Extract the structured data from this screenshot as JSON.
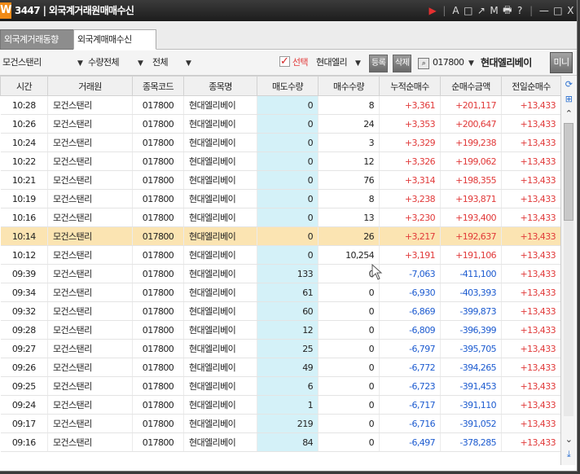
{
  "window": {
    "logo": "W",
    "title": "3447 | 외국계거래원매매수신",
    "controls": [
      "A",
      "□",
      "↗",
      "M",
      "🖶",
      "?",
      "|",
      "—",
      "□",
      "X"
    ]
  },
  "tabs": [
    {
      "label": "외국계거래동향"
    },
    {
      "label": "외국계매매수신"
    }
  ],
  "toolbar": {
    "broker": "모건스탠리",
    "qty_filter": "수량전체",
    "all_filter": "전체",
    "select_label": "선택",
    "stock_select": "현대엘리",
    "register": "등록",
    "delete": "삭제",
    "code": "017800",
    "stock_name": "현대엘리베이",
    "mini": "미니"
  },
  "table": {
    "headers": [
      "시간",
      "거래원",
      "종목코드",
      "종목명",
      "매도수량",
      "매수수량",
      "누적순매수",
      "순매수금액",
      "전일순매수"
    ],
    "rows": [
      {
        "time": "10:28",
        "broker": "모건스탠리",
        "code": "017800",
        "name": "현대엘리베이",
        "sell": "0",
        "buy": "8",
        "cum": "+3,361",
        "amt": "+201,117",
        "prev": "+13,433"
      },
      {
        "time": "10:26",
        "broker": "모건스탠리",
        "code": "017800",
        "name": "현대엘리베이",
        "sell": "0",
        "buy": "24",
        "cum": "+3,353",
        "amt": "+200,647",
        "prev": "+13,433"
      },
      {
        "time": "10:24",
        "broker": "모건스탠리",
        "code": "017800",
        "name": "현대엘리베이",
        "sell": "0",
        "buy": "3",
        "cum": "+3,329",
        "amt": "+199,238",
        "prev": "+13,433"
      },
      {
        "time": "10:22",
        "broker": "모건스탠리",
        "code": "017800",
        "name": "현대엘리베이",
        "sell": "0",
        "buy": "12",
        "cum": "+3,326",
        "amt": "+199,062",
        "prev": "+13,433"
      },
      {
        "time": "10:21",
        "broker": "모건스탠리",
        "code": "017800",
        "name": "현대엘리베이",
        "sell": "0",
        "buy": "76",
        "cum": "+3,314",
        "amt": "+198,355",
        "prev": "+13,433"
      },
      {
        "time": "10:19",
        "broker": "모건스탠리",
        "code": "017800",
        "name": "현대엘리베이",
        "sell": "0",
        "buy": "8",
        "cum": "+3,238",
        "amt": "+193,871",
        "prev": "+13,433"
      },
      {
        "time": "10:16",
        "broker": "모건스탠리",
        "code": "017800",
        "name": "현대엘리베이",
        "sell": "0",
        "buy": "13",
        "cum": "+3,230",
        "amt": "+193,400",
        "prev": "+13,433"
      },
      {
        "time": "10:14",
        "broker": "모건스탠리",
        "code": "017800",
        "name": "현대엘리베이",
        "sell": "0",
        "buy": "26",
        "cum": "+3,217",
        "amt": "+192,637",
        "prev": "+13,433",
        "selected": true
      },
      {
        "time": "10:12",
        "broker": "모건스탠리",
        "code": "017800",
        "name": "현대엘리베이",
        "sell": "0",
        "buy": "10,254",
        "cum": "+3,191",
        "amt": "+191,106",
        "prev": "+13,433"
      },
      {
        "time": "09:39",
        "broker": "모건스탠리",
        "code": "017800",
        "name": "현대엘리베이",
        "sell": "133",
        "buy": "0",
        "cum": "-7,063",
        "amt": "-411,100",
        "prev": "+13,433"
      },
      {
        "time": "09:34",
        "broker": "모건스탠리",
        "code": "017800",
        "name": "현대엘리베이",
        "sell": "61",
        "buy": "0",
        "cum": "-6,930",
        "amt": "-403,393",
        "prev": "+13,433"
      },
      {
        "time": "09:32",
        "broker": "모건스탠리",
        "code": "017800",
        "name": "현대엘리베이",
        "sell": "60",
        "buy": "0",
        "cum": "-6,869",
        "amt": "-399,873",
        "prev": "+13,433"
      },
      {
        "time": "09:28",
        "broker": "모건스탠리",
        "code": "017800",
        "name": "현대엘리베이",
        "sell": "12",
        "buy": "0",
        "cum": "-6,809",
        "amt": "-396,399",
        "prev": "+13,433"
      },
      {
        "time": "09:27",
        "broker": "모건스탠리",
        "code": "017800",
        "name": "현대엘리베이",
        "sell": "25",
        "buy": "0",
        "cum": "-6,797",
        "amt": "-395,705",
        "prev": "+13,433"
      },
      {
        "time": "09:26",
        "broker": "모건스탠리",
        "code": "017800",
        "name": "현대엘리베이",
        "sell": "49",
        "buy": "0",
        "cum": "-6,772",
        "amt": "-394,265",
        "prev": "+13,433"
      },
      {
        "time": "09:25",
        "broker": "모건스탠리",
        "code": "017800",
        "name": "현대엘리베이",
        "sell": "6",
        "buy": "0",
        "cum": "-6,723",
        "amt": "-391,453",
        "prev": "+13,433"
      },
      {
        "time": "09:24",
        "broker": "모건스탠리",
        "code": "017800",
        "name": "현대엘리베이",
        "sell": "1",
        "buy": "0",
        "cum": "-6,717",
        "amt": "-391,110",
        "prev": "+13,433"
      },
      {
        "time": "09:17",
        "broker": "모건스탠리",
        "code": "017800",
        "name": "현대엘리베이",
        "sell": "219",
        "buy": "0",
        "cum": "-6,716",
        "amt": "-391,052",
        "prev": "+13,433"
      },
      {
        "time": "09:16",
        "broker": "모건스탠리",
        "code": "017800",
        "name": "현대엘리베이",
        "sell": "84",
        "buy": "0",
        "cum": "-6,497",
        "amt": "-378,285",
        "prev": "+13,433"
      }
    ]
  },
  "colors": {
    "up": "#e13a3a",
    "down": "#1e5cd0",
    "sell_column": "#d4f1f8",
    "selected_row": "#fbe4b2"
  },
  "icons": {
    "refresh": "refresh-icon",
    "settings": "grid-settings-icon",
    "scroll_up": "scroll-up-icon",
    "scroll_down": "scroll-down-icon",
    "scroll_end": "scroll-end-icon"
  }
}
